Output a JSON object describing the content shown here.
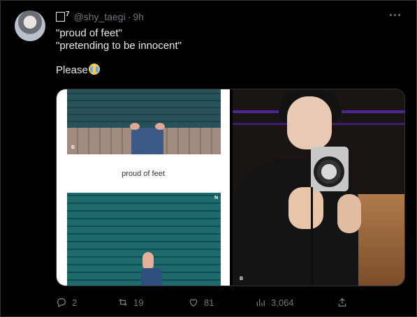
{
  "tweet": {
    "display_name": "□",
    "name_suffix": "7",
    "handle": "@shy_taegi",
    "separator": "·",
    "time": "9h",
    "lines": [
      "\"proud of feet\"",
      "\"pretending to be innocent\""
    ],
    "closing": "Please",
    "closing_emoji": "loudly-crying-face-icon"
  },
  "media": {
    "caption": "proud of feet",
    "logo_left": "B",
    "logo_right": "B",
    "mark_top_right": "N"
  },
  "actions": {
    "reply_count": "2",
    "retweet_count": "19",
    "like_count": "81",
    "views_count": "3,064"
  },
  "colors": {
    "background": "#000000",
    "text": "#e7e9ea",
    "muted": "#71767b",
    "border": "#2f3336"
  }
}
